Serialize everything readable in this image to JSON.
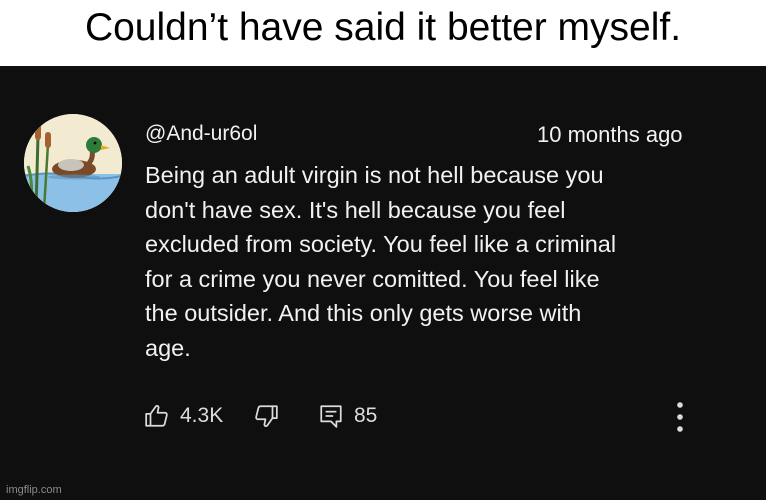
{
  "meme_caption": "Couldn’t have said it better myself.",
  "comment": {
    "username": "@And-ur6ol",
    "timestamp": "10 months ago",
    "body_lines": [
      "Being an adult virgin is not hell because you",
      "don't have sex. It's hell because you feel",
      "excluded from society. You feel like a criminal",
      "for a crime you never comitted. You feel like",
      "the outsider. And this only gets worse with",
      "age."
    ],
    "likes": "4.3K",
    "replies": "85"
  },
  "icons": {
    "avatar": "duck-avatar-icon",
    "like": "thumbs-up-icon",
    "dislike": "thumbs-down-icon",
    "reply": "reply-comment-icon",
    "more": "more-vertical-icon"
  },
  "colors": {
    "panel_background": "#0f0f0f",
    "text": "#f1f1f1",
    "caption_background": "#ffffff"
  },
  "watermark": "imgflip.com"
}
